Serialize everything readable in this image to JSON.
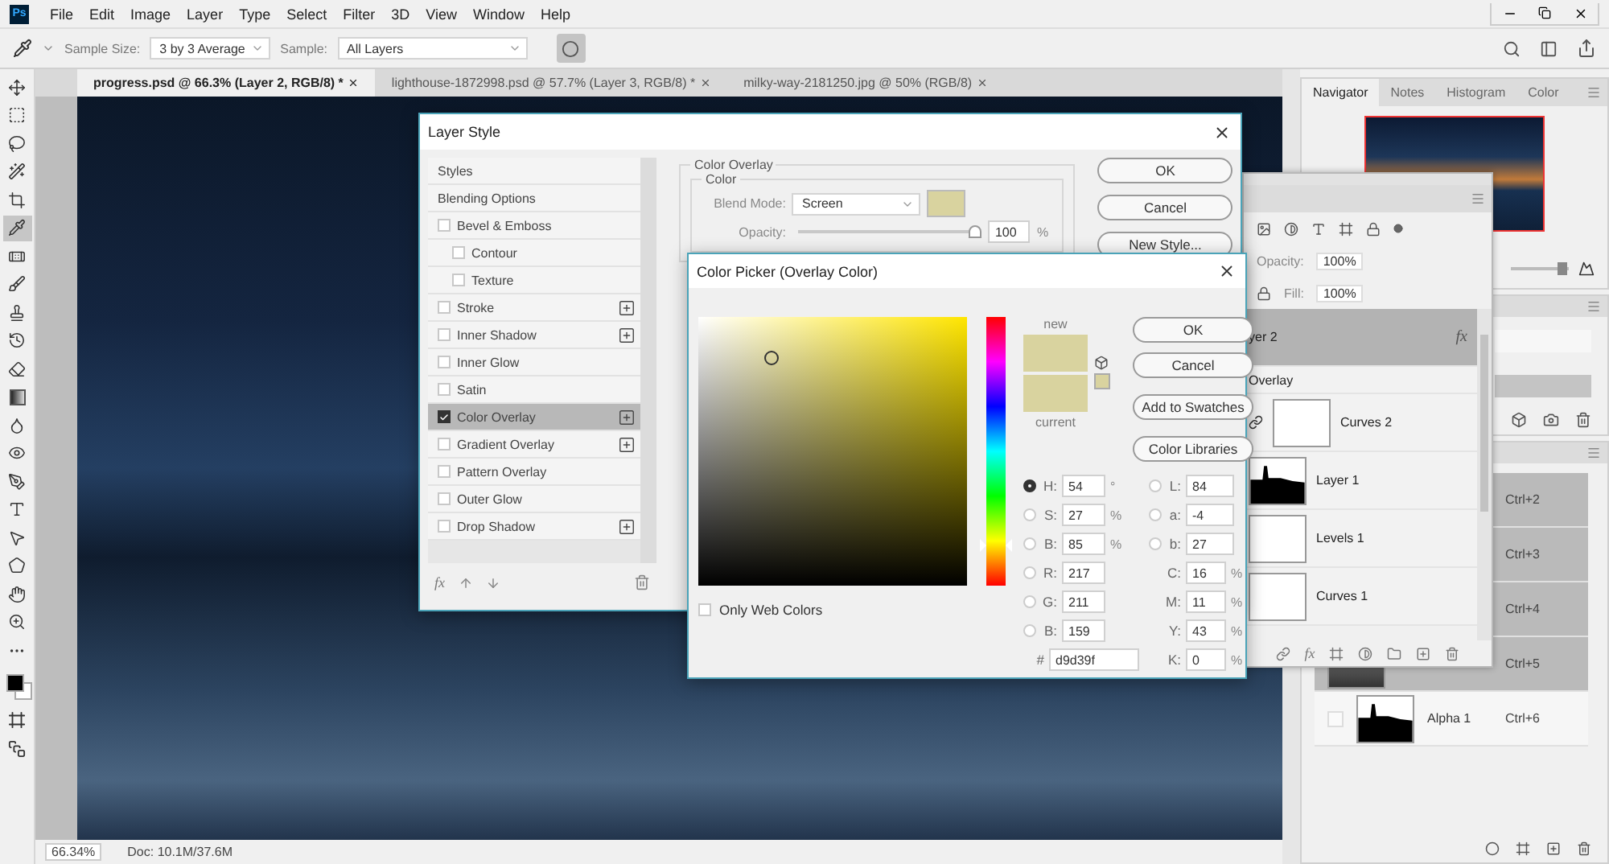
{
  "app": {
    "logo": "Ps",
    "menu": [
      "File",
      "Edit",
      "Image",
      "Layer",
      "Type",
      "Select",
      "Filter",
      "3D",
      "View",
      "Window",
      "Help"
    ]
  },
  "options_bar": {
    "sample_size_label": "Sample Size:",
    "sample_size": "3 by 3 Average",
    "sample_label": "Sample:",
    "sample": "All Layers"
  },
  "doc_tabs": [
    {
      "label": "progress.psd @ 66.3% (Layer 2, RGB/8) *",
      "selected": true
    },
    {
      "label": "lighthouse-1872998.psd @ 57.7% (Layer 3, RGB/8) *",
      "selected": false
    },
    {
      "label": "milky-way-2181250.jpg @ 50% (RGB/8)",
      "selected": false
    }
  ],
  "tools": [
    {
      "selected": false
    },
    {
      "selected": false
    },
    {
      "selected": false
    },
    {
      "selected": false
    },
    {
      "selected": false
    },
    {
      "selected": true
    },
    {
      "selected": false
    },
    {
      "selected": false
    },
    {
      "selected": false
    },
    {
      "selected": false
    },
    {
      "selected": false
    },
    {
      "selected": false
    },
    {
      "selected": false
    },
    {
      "selected": false
    },
    {
      "selected": false
    },
    {
      "selected": false
    },
    {
      "selected": false
    },
    {
      "selected": false
    },
    {
      "selected": false
    },
    {
      "selected": false
    },
    {
      "selected": false
    }
  ],
  "status_bar": {
    "zoom": "66.34%",
    "doc": "Doc: 10.1M/37.6M"
  },
  "navigator": {
    "tabs": [
      {
        "label": "Navigator",
        "selected": true
      },
      {
        "label": "Notes",
        "selected": false
      },
      {
        "label": "Histogram",
        "selected": false
      },
      {
        "label": "Color",
        "selected": false
      }
    ],
    "zoom_slider": {
      "level": 0.9
    }
  },
  "channels": [
    {
      "kind": "plain",
      "shortcut": "Ctrl+2",
      "selected": true
    },
    {
      "kind": "plain",
      "shortcut": "Ctrl+3",
      "selected": true
    },
    {
      "kind": "plain",
      "shortcut": "Ctrl+4",
      "selected": true
    },
    {
      "kind": "photo",
      "shortcut": "Ctrl+5",
      "selected": true
    },
    {
      "kind": "alpha",
      "name": "Alpha 1",
      "shortcut": "Ctrl+6",
      "selected": false
    }
  ],
  "layers_panel": {
    "opacity_label": "Opacity:",
    "opacity": "100%",
    "fill_label": "Fill:",
    "fill": "100%",
    "footer_fx_label": "fx",
    "layers": [
      {
        "kind": "layer",
        "name": "yer 2",
        "selected": true,
        "effects_label": "fx",
        "linked": false
      },
      {
        "kind": "effect",
        "name": "Overlay",
        "selected": false
      },
      {
        "kind": "adjustment",
        "name": "Curves 2",
        "selected": false,
        "linked": true
      },
      {
        "kind": "pixel",
        "name": "Layer 1",
        "selected": false,
        "linked": false
      },
      {
        "kind": "adjustment",
        "name": "Levels 1",
        "selected": false,
        "linked": false
      },
      {
        "kind": "adjustment",
        "name": "Curves 1",
        "selected": false,
        "linked": false
      }
    ]
  },
  "layer_style": {
    "title": "Layer Style",
    "fx_label": "fx",
    "styles": [
      {
        "kind": "header",
        "label": "Styles",
        "selected": false
      },
      {
        "kind": "header",
        "label": "Blending Options",
        "selected": false
      },
      {
        "kind": "effect",
        "label": "Bevel & Emboss",
        "checked": false,
        "selected": false,
        "addable": false,
        "children": [
          {
            "kind": "effect",
            "label": "Contour",
            "checked": false,
            "selected": false,
            "addable": false
          },
          {
            "kind": "effect",
            "label": "Texture",
            "checked": false,
            "selected": false,
            "addable": false
          }
        ]
      },
      {
        "kind": "effect",
        "label": "Stroke",
        "checked": false,
        "selected": false,
        "addable": true
      },
      {
        "kind": "effect",
        "label": "Inner Shadow",
        "checked": false,
        "selected": false,
        "addable": true
      },
      {
        "kind": "effect",
        "label": "Inner Glow",
        "checked": false,
        "selected": false,
        "addable": false
      },
      {
        "kind": "effect",
        "label": "Satin",
        "checked": false,
        "selected": false,
        "addable": false
      },
      {
        "kind": "effect",
        "label": "Color Overlay",
        "checked": true,
        "selected": true,
        "addable": true
      },
      {
        "kind": "effect",
        "label": "Gradient Overlay",
        "checked": false,
        "selected": false,
        "addable": true
      },
      {
        "kind": "effect",
        "label": "Pattern Overlay",
        "checked": false,
        "selected": false,
        "addable": false
      },
      {
        "kind": "effect",
        "label": "Outer Glow",
        "checked": false,
        "selected": false,
        "addable": false
      },
      {
        "kind": "effect",
        "label": "Drop Shadow",
        "checked": false,
        "selected": false,
        "addable": true
      }
    ],
    "section_title": "Color Overlay",
    "group_title": "Color",
    "blend_mode_label": "Blend Mode:",
    "blend_mode": "Screen",
    "color": "#d9d39f",
    "opacity_label": "Opacity:",
    "opacity": "100",
    "opacity_unit": "%",
    "opacity_slider": {
      "level": 1
    },
    "buttons": [
      "OK",
      "Cancel",
      "New Style..."
    ]
  },
  "color_picker": {
    "title": "Color Picker (Overlay Color)",
    "swatches": [
      {
        "label": "new",
        "color": "#d9d39f"
      },
      {
        "label": "current",
        "color": "#d9d39f"
      }
    ],
    "hue_slider": {
      "level": 0.85
    },
    "buttons": [
      "OK",
      "Cancel",
      "Add to Swatches",
      "Color Libraries"
    ],
    "hsb_rgb": [
      {
        "label": "H:",
        "value": "54",
        "unit": "°",
        "selected": true
      },
      {
        "label": "S:",
        "value": "27",
        "unit": "%",
        "selected": false
      },
      {
        "label": "B:",
        "value": "85",
        "unit": "%",
        "selected": false
      },
      {
        "label": "R:",
        "value": "217",
        "selected": false
      },
      {
        "label": "G:",
        "value": "211",
        "selected": false
      },
      {
        "label": "B:",
        "value": "159",
        "selected": false
      }
    ],
    "lab": [
      {
        "label": "L:",
        "value": "84",
        "selected": false
      },
      {
        "label": "a:",
        "value": "-4",
        "selected": false
      },
      {
        "label": "b:",
        "value": "27",
        "selected": false
      }
    ],
    "cmyk": [
      {
        "label": "C:",
        "value": "16",
        "unit": "%"
      },
      {
        "label": "M:",
        "value": "11",
        "unit": "%"
      },
      {
        "label": "Y:",
        "value": "43",
        "unit": "%"
      },
      {
        "label": "K:",
        "value": "0",
        "unit": "%"
      }
    ],
    "hex_label": "#",
    "hex": "d9d39f",
    "only_web_colors": {
      "label": "Only Web Colors",
      "checked": false
    }
  }
}
